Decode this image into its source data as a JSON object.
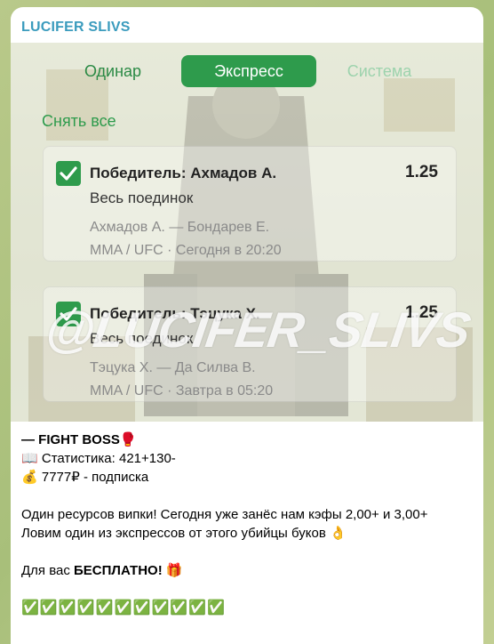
{
  "channel": {
    "name": "LUCIFER SLIVS"
  },
  "screenshot": {
    "tabs": [
      {
        "label": "Одинар"
      },
      {
        "label": "Экспресс"
      },
      {
        "label": "Система"
      }
    ],
    "clear_all": "Снять все",
    "bets": [
      {
        "selection": "Победитель: Ахмадов А.",
        "period": "Весь поединок",
        "odds": "1.25",
        "match": "Ахмадов А. — Бондарев Е.",
        "meta": "MMA / UFC · Сегодня в 20:20"
      },
      {
        "selection": "Победитель: Тэцука Х.",
        "period": "Весь поединок",
        "odds": "1.25",
        "match": "Тэцука Х. — Да Силва В.",
        "meta": "MMA / UFC · Завтра в 05:20"
      }
    ],
    "watermark": "@LUCIFER_SLIVS"
  },
  "post": {
    "title_prefix": "— ",
    "title": "FIGHT BOSS",
    "title_emoji": "🥊",
    "stats_emoji": "📖",
    "stats": "Статистика: 421+130-",
    "price_emoji": "💰",
    "price": "7777₽ - подписка",
    "para1": "Один ресурсов випки! Сегодня уже занёс нам кэфы 2,00+ и 3,00+",
    "para2": "Ловим один из экспрессов от этого убийцы буков",
    "para2_emoji": "👌",
    "free_prefix": "Для вас ",
    "free_bold": "БЕСПЛАТНО!",
    "free_emoji": "🎁",
    "checks": "✅✅✅✅✅✅✅✅✅✅✅"
  }
}
